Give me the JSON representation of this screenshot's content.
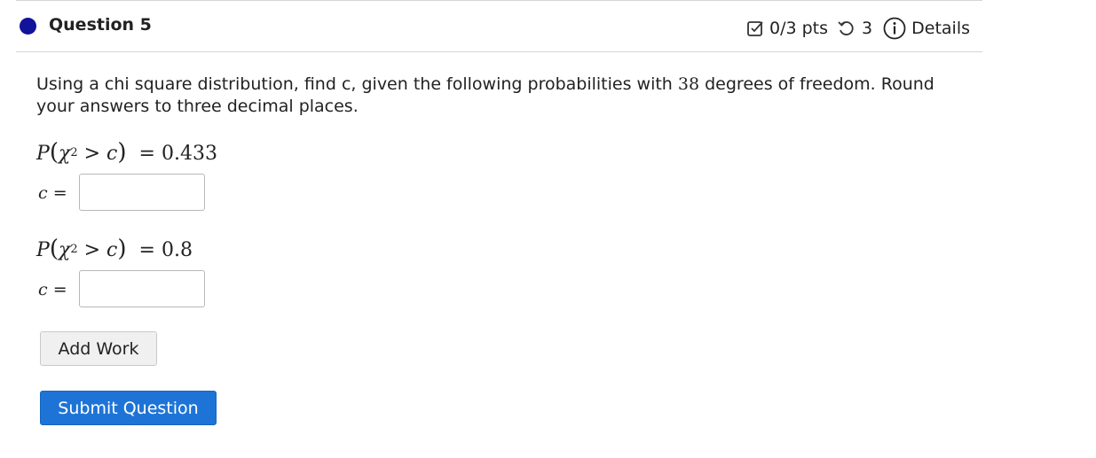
{
  "question": {
    "title": "Question 5",
    "score": "0/3 pts",
    "attempts": "3",
    "details_label": "Details",
    "text_before": "Using a chi square distribution, find c, given the following probabilities with ",
    "degrees": "38",
    "text_after": " degrees of freedom. Round your answers to three decimal places."
  },
  "parts": [
    {
      "prob_lhs": "P",
      "var": "χ",
      "exp": "2",
      "op": ">",
      "c": "c",
      "equals": "=",
      "value": "0.433",
      "answer_label": "c",
      "answer_equals": "=",
      "answer_value": ""
    },
    {
      "prob_lhs": "P",
      "var": "χ",
      "exp": "2",
      "op": ">",
      "c": "c",
      "equals": "=",
      "value": "0.8",
      "answer_label": "c",
      "answer_equals": "=",
      "answer_value": ""
    }
  ],
  "buttons": {
    "add_work": "Add Work",
    "submit": "Submit Question"
  },
  "colors": {
    "status_dot": "#12129a",
    "submit_bg": "#1e74d6",
    "divider": "#d6d6d6"
  },
  "icons": {
    "score": "checkbox-icon",
    "attempts": "retry-icon",
    "details": "info-icon"
  }
}
